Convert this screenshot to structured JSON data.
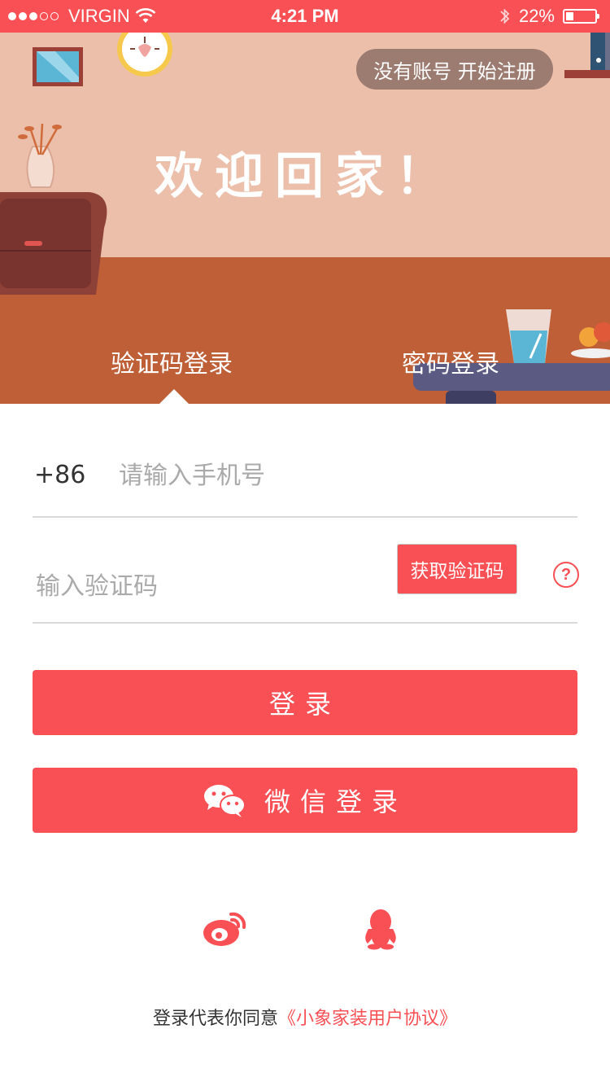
{
  "status_bar": {
    "carrier": "VIRGIN",
    "time": "4:21 PM",
    "battery": "22%",
    "battery_level": 0.22
  },
  "hero": {
    "register_label": "没有账号 开始注册",
    "welcome": "欢迎回家！",
    "tabs": [
      {
        "label": "验证码登录",
        "active": true
      },
      {
        "label": "密码登录",
        "active": false
      }
    ]
  },
  "form": {
    "country_code": "+86",
    "phone_placeholder": "请输入手机号",
    "code_placeholder": "输入验证码",
    "get_code_label": "获取验证码",
    "help_glyph": "?"
  },
  "buttons": {
    "login": "登录",
    "wechat_login": "微信登录"
  },
  "social": {
    "icons": [
      "weibo-icon",
      "qq-icon"
    ]
  },
  "agreement": {
    "prefix": "登录代表你同意",
    "link": "《小象家装用户协议》"
  },
  "colors": {
    "accent": "#f85054",
    "wall": "#ebbfaa",
    "floor": "#bf5f37",
    "register_pill": "#9c7b70"
  }
}
